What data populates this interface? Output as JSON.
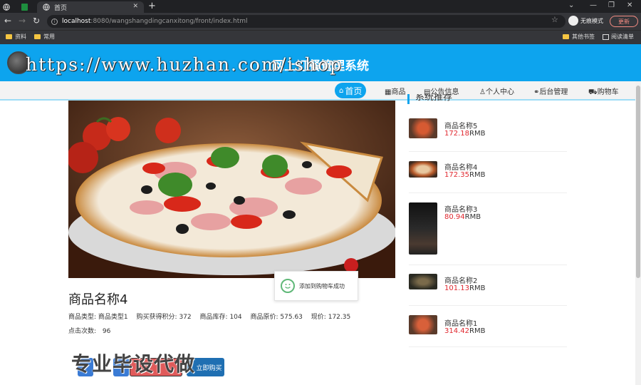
{
  "browser": {
    "tab_title": "首页",
    "url_host": "localhost",
    "url_path": ":8080/wangshangdingcanxitong/front/index.html",
    "profile_label": "无痕模式",
    "update_label": "更新",
    "bookmarks": [
      "资料",
      "常用"
    ],
    "bookmarks_right": [
      "其他书签",
      "阅读清单"
    ]
  },
  "site": {
    "title": "网上订餐管理系统",
    "watermark_url": "https://www.huzhan.com/ishop",
    "watermark_cn": "专业毕设代做"
  },
  "nav": {
    "items": [
      "首页",
      "商品",
      "公告信息",
      "个人中心",
      "后台管理",
      "购物车"
    ]
  },
  "product": {
    "name": "商品名称4",
    "meta": [
      {
        "label": "商品类型:",
        "value": "商品类型1"
      },
      {
        "label": "购买获得积分:",
        "value": "372"
      },
      {
        "label": "商品库存:",
        "value": "104"
      },
      {
        "label": "商品原价:",
        "value": "575.63"
      },
      {
        "label": "现价:",
        "value": "172.35"
      }
    ],
    "clicks_label": "点击次数:",
    "clicks_value": "96",
    "buy_label": "立即购买"
  },
  "toast": {
    "message": "添加到购物车成功"
  },
  "sidebar": {
    "title": "系统推荐",
    "unit": "RMB",
    "items": [
      {
        "name": "商品名称5",
        "price": "172.18"
      },
      {
        "name": "商品名称4",
        "price": "172.35"
      },
      {
        "name": "商品名称3",
        "price": "80.94"
      },
      {
        "name": "商品名称2",
        "price": "101.13"
      },
      {
        "name": "商品名称1",
        "price": "314.42"
      }
    ]
  },
  "colors": {
    "brand": "#0da4ee",
    "price": "#e0282f"
  }
}
